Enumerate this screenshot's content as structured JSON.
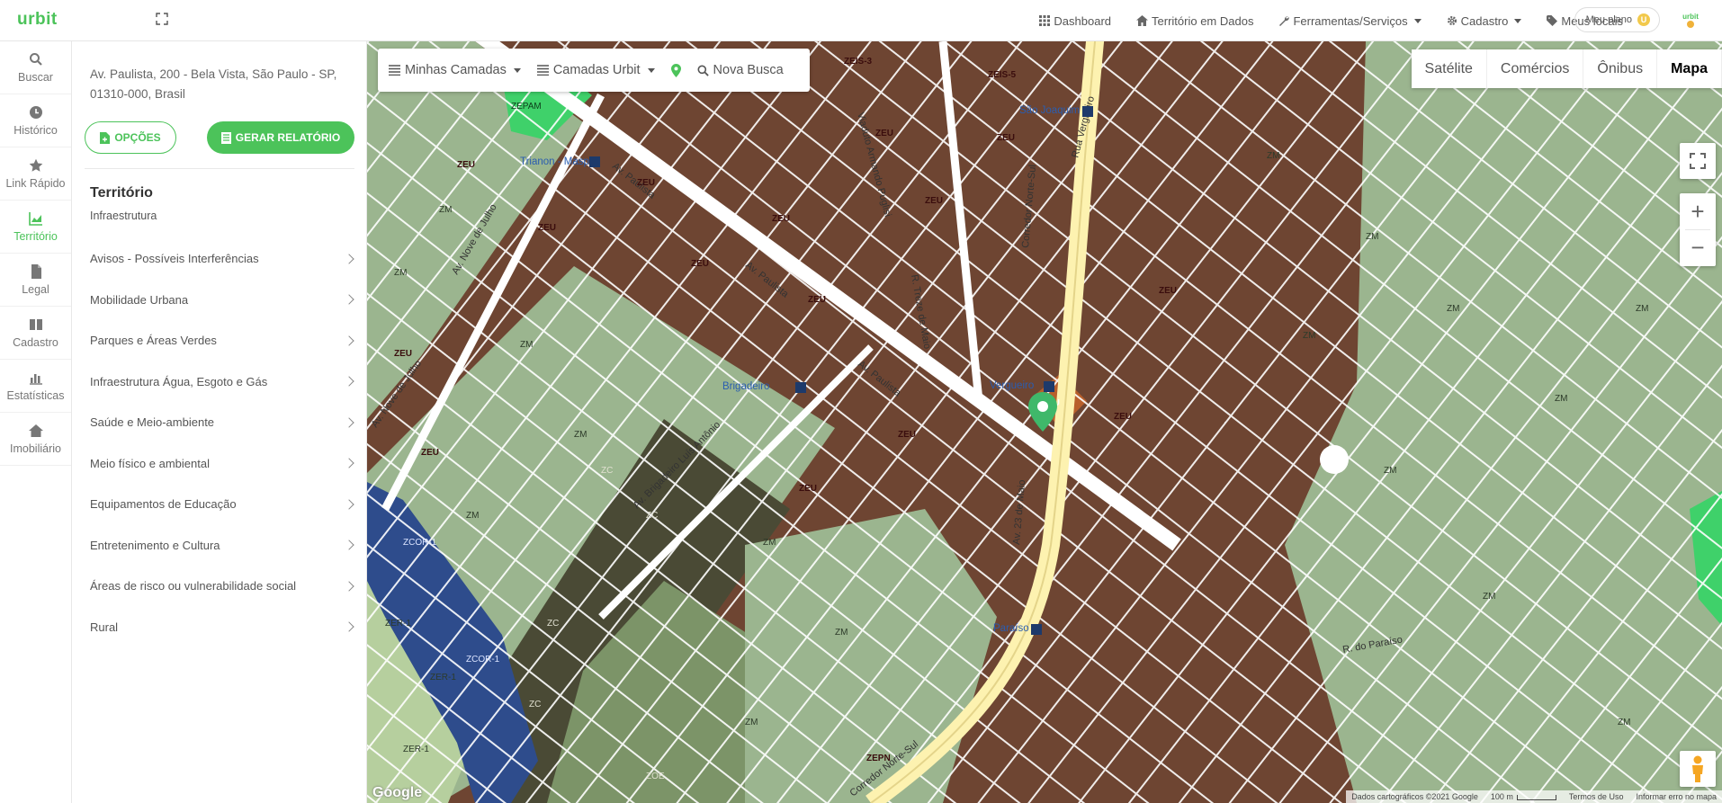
{
  "brand": {
    "logo": "urbit",
    "mini_logo": "urbit"
  },
  "topnav": {
    "items": [
      {
        "label": "Dashboard",
        "icon": "grid-icon"
      },
      {
        "label": "Território em Dados",
        "icon": "home-icon"
      },
      {
        "label": "Ferramentas/Serviços",
        "icon": "wrench-icon"
      },
      {
        "label": "Cadastro",
        "icon": "gear-icon"
      },
      {
        "label": "Meus locais",
        "icon": "tag-icon"
      }
    ],
    "plan_label": "Meu plano",
    "plan_coin": "U"
  },
  "rail": {
    "items": [
      {
        "label": "Buscar",
        "icon": "search-icon"
      },
      {
        "label": "Histórico",
        "icon": "clock-icon"
      },
      {
        "label": "Link Rápido",
        "icon": "star-icon"
      },
      {
        "label": "Território",
        "icon": "chart-area-icon",
        "active": true
      },
      {
        "label": "Legal",
        "icon": "file-icon"
      },
      {
        "label": "Cadastro",
        "icon": "book-icon"
      },
      {
        "label": "Estatísticas",
        "icon": "bar-chart-icon"
      },
      {
        "label": "Imobiliário",
        "icon": "house-icon"
      }
    ]
  },
  "panel": {
    "address": "Av. Paulista, 200 - Bela Vista, São Paulo - SP, 01310-000, Brasil",
    "options_label": "OPÇÕES",
    "report_label": "GERAR RELATÓRIO",
    "section_title": "Território",
    "section_subtitle": "Infraestrutura",
    "menu": [
      "Avisos - Possíveis Interferências",
      "Mobilidade Urbana",
      "Parques e Áreas Verdes",
      "Infraestrutura Água, Esgoto e Gás",
      "Saúde e Meio-ambiente",
      "Meio físico e ambiental",
      "Equipamentos de Educação",
      "Entretenimento e Cultura",
      "Áreas de risco ou vulnerabilidade social",
      "Rural"
    ]
  },
  "map": {
    "toolbar": {
      "my_layers": "Minhas Camadas",
      "urbit_layers": "Camadas Urbit",
      "new_search": "Nova Busca"
    },
    "map_types": [
      "Satélite",
      "Comércios",
      "Ônibus",
      "Mapa"
    ],
    "active_map_type": "Mapa",
    "zoom_in": "+",
    "zoom_out": "−",
    "google_label": "Google",
    "attribution": {
      "data": "Dados cartográficos ©2021 Google",
      "scale": "100 m",
      "terms": "Termos de Uso",
      "report": "Informar erro no mapa"
    },
    "street_labels": {
      "paulista_1": "Av. Paulista",
      "paulista_2": "Av. Paulista",
      "paulista_3": "Av. Paulista",
      "nove_julho_1": "Av. Nove de Julho",
      "nove_julho_2": "Av. Nove de Julho",
      "viaduto": "Viaduto Armando Puglisi",
      "treze_maio": "R. Treze de Maio",
      "corredor_1": "Corredor Norte-Sul",
      "corredor_2": "Corredor Norte-Sul",
      "vinte_tres": "Av. 23 de Maio",
      "brigadeiro": "Av. Brigadeiro Luís Antônio",
      "vergueiro": "Rua Vergueiro",
      "paraiso_rua": "R. do Paraíso"
    },
    "stations": {
      "trianon": "Trianon - Masp",
      "sao_joaquim": "São Joaquim",
      "brigadeiro": "Brigadeiro",
      "vergueiro": "Vergueiro",
      "paraiso": "Paraíso"
    },
    "zones": {
      "zeu": "ZEU",
      "zm": "ZM",
      "zc": "ZC",
      "zepam": "ZEPAM",
      "zer": "ZER-1",
      "zcor": "ZCOR-1",
      "zeis": "ZEIS-3",
      "zeis5": "ZEIS-5",
      "zoe": "ZOE",
      "zepn": "ZEPN",
      "zecor": "ZCOR-1"
    },
    "colors": {
      "zeu": "#6e4532",
      "zm": "#9bb58f",
      "zc": "#4a4a35",
      "zer": "#b6cf9e",
      "zcor": "#2e4c8c",
      "zepam": "#3fd16a",
      "selected": "#c0622a",
      "road": "#ffffff",
      "highway": "#fdf2b0"
    }
  }
}
